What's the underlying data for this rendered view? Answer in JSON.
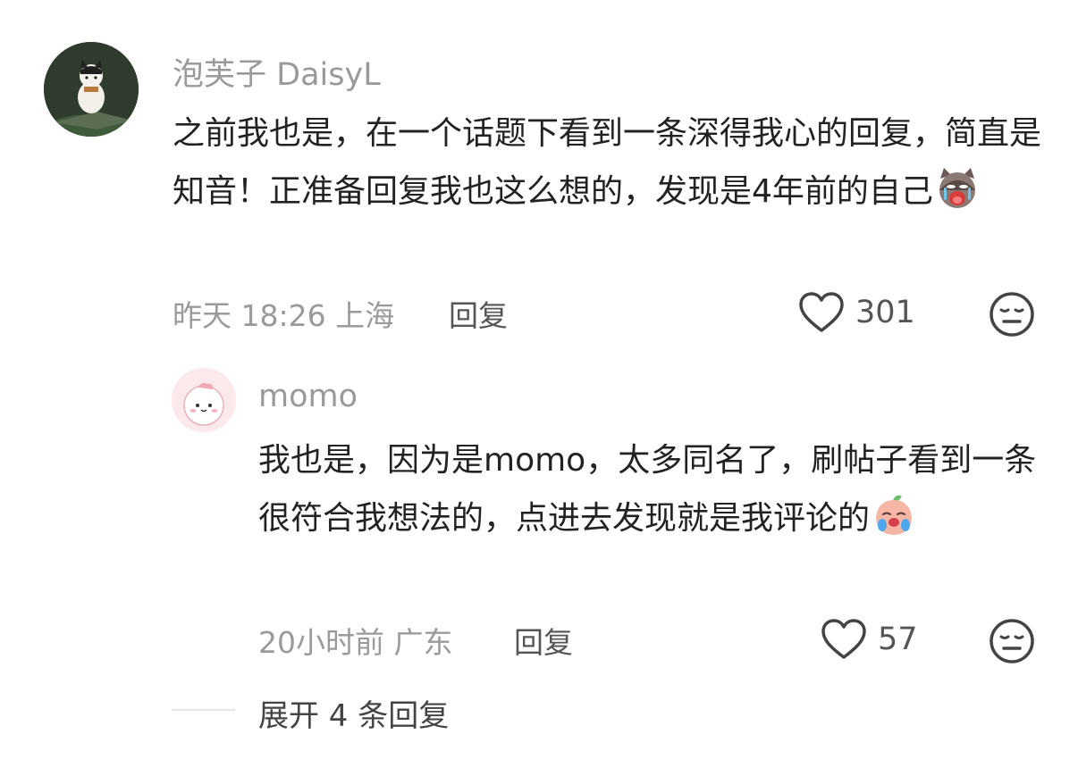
{
  "comment": {
    "username": "泡芙子 DaisyL",
    "text": "之前我也是，在一个话题下看到一条深得我心的回复，简直是知音！正准备回复我也这么想的，发现是4年前的自己",
    "time": "昨天 18:26 上海",
    "reply_label": "回复",
    "like_count": "301",
    "emoji": "crying-cat-emoji"
  },
  "reply": {
    "username": "momo",
    "text": "我也是，因为是momo，太多同名了，刷帖子看到一条很符合我想法的，点进去发现就是我评论的",
    "time": "20小时前 广东",
    "reply_label": "回复",
    "like_count": "57",
    "emoji": "crying-peach-emoji"
  },
  "expand_label": "展开 4 条回复",
  "colors": {
    "text": "#222222",
    "muted": "#9a9a9a",
    "secondary": "#555555"
  }
}
